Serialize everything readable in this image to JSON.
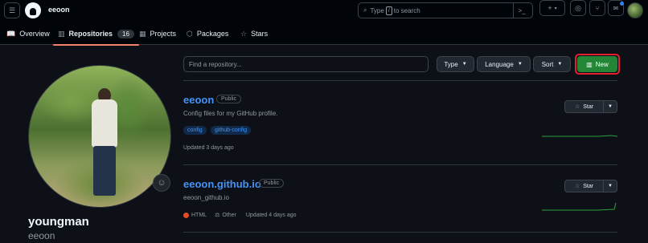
{
  "header": {
    "owner": "eeoon",
    "search_prefix": "Type",
    "search_key": "/",
    "search_suffix": "to search",
    "plus_label": "+"
  },
  "nav": {
    "tabs": [
      {
        "label": "Overview",
        "icon": "book-icon"
      },
      {
        "label": "Repositories",
        "icon": "repo-icon",
        "count": "16"
      },
      {
        "label": "Projects",
        "icon": "table-icon"
      },
      {
        "label": "Packages",
        "icon": "package-icon"
      },
      {
        "label": "Stars",
        "icon": "star-icon"
      }
    ]
  },
  "profile": {
    "display_name": "youngman",
    "login": "eeoon"
  },
  "toolbar": {
    "find_placeholder": "Find a repository...",
    "type_label": "Type",
    "language_label": "Language",
    "sort_label": "Sort",
    "new_label": "New"
  },
  "repos": [
    {
      "name": "eeoon",
      "visibility": "Public",
      "description": "Config files for my GitHub profile.",
      "topics": [
        "config",
        "github-config"
      ],
      "updated": "Updated 3 days ago",
      "star_label": "Star"
    },
    {
      "name": "eeoon.github.io",
      "visibility": "Public",
      "description": "eeoon_github.io",
      "language": "HTML",
      "license": "Other",
      "updated": "Updated 4 days ago",
      "star_label": "Star"
    }
  ],
  "colors": {
    "accent": "#4493f8",
    "new_button": "#238636",
    "highlight": "#e5202e",
    "html_lang": "#e34c26"
  }
}
